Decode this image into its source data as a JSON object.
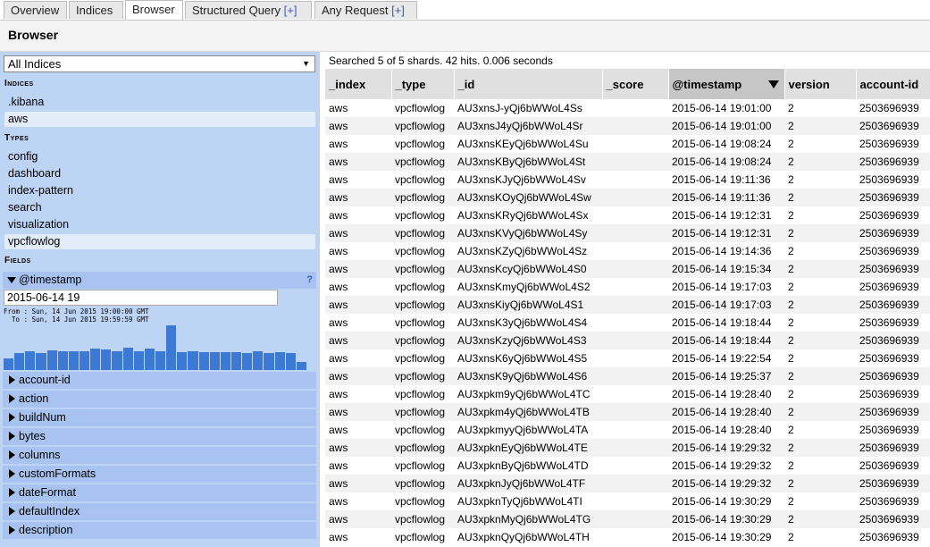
{
  "tabs": [
    {
      "label": "Overview"
    },
    {
      "label": "Indices"
    },
    {
      "label": "Browser"
    },
    {
      "label": "Structured Query",
      "plus": "[+]"
    },
    {
      "label": "Any Request",
      "plus": "[+]"
    }
  ],
  "header": {
    "title": "Browser"
  },
  "sidebar": {
    "index_select": "All Indices",
    "indices_title": "Indices",
    "indices": [
      ".kibana",
      "aws"
    ],
    "types_title": "Types",
    "types": [
      "config",
      "dashboard",
      "index-pattern",
      "search",
      "visualization",
      "vpcflowlog"
    ],
    "fields_title": "Fields",
    "timestamp": {
      "label": "@timestamp",
      "help": "?",
      "value": "2015-06-14 19",
      "from": "From : Sun, 14 Jun 2015 19:00:00 GMT",
      "to": "  To : Sun, 14 Jun 2015 19:59:59 GMT",
      "histogram": [
        13,
        19,
        21,
        19,
        22,
        21,
        21,
        21,
        24,
        23,
        21,
        25,
        21,
        24,
        21,
        50,
        20,
        21,
        20,
        20,
        20,
        20,
        19,
        21,
        19,
        20,
        19,
        9
      ]
    },
    "fields": [
      "account-id",
      "action",
      "buildNum",
      "bytes",
      "columns",
      "customFormats",
      "dateFormat",
      "defaultIndex",
      "description"
    ]
  },
  "results": {
    "summary": "Searched 5 of 5 shards. 42 hits. 0.006 seconds",
    "columns": [
      "_index",
      "_type",
      "_id",
      "_score",
      "@timestamp",
      "version",
      "account-id"
    ],
    "rows": [
      [
        "aws",
        "vpcflowlog",
        "AU3xnsJ-yQj6bWWoL4Ss",
        "",
        "2015-06-14 19:01:00",
        "2",
        "2503696939"
      ],
      [
        "aws",
        "vpcflowlog",
        "AU3xnsJ4yQj6bWWoL4Sr",
        "",
        "2015-06-14 19:01:00",
        "2",
        "2503696939"
      ],
      [
        "aws",
        "vpcflowlog",
        "AU3xnsKEyQj6bWWoL4Su",
        "",
        "2015-06-14 19:08:24",
        "2",
        "2503696939"
      ],
      [
        "aws",
        "vpcflowlog",
        "AU3xnsKByQj6bWWoL4St",
        "",
        "2015-06-14 19:08:24",
        "2",
        "2503696939"
      ],
      [
        "aws",
        "vpcflowlog",
        "AU3xnsKJyQj6bWWoL4Sv",
        "",
        "2015-06-14 19:11:36",
        "2",
        "2503696939"
      ],
      [
        "aws",
        "vpcflowlog",
        "AU3xnsKOyQj6bWWoL4Sw",
        "",
        "2015-06-14 19:11:36",
        "2",
        "2503696939"
      ],
      [
        "aws",
        "vpcflowlog",
        "AU3xnsKRyQj6bWWoL4Sx",
        "",
        "2015-06-14 19:12:31",
        "2",
        "2503696939"
      ],
      [
        "aws",
        "vpcflowlog",
        "AU3xnsKVyQj6bWWoL4Sy",
        "",
        "2015-06-14 19:12:31",
        "2",
        "2503696939"
      ],
      [
        "aws",
        "vpcflowlog",
        "AU3xnsKZyQj6bWWoL4Sz",
        "",
        "2015-06-14 19:14:36",
        "2",
        "2503696939"
      ],
      [
        "aws",
        "vpcflowlog",
        "AU3xnsKcyQj6bWWoL4S0",
        "",
        "2015-06-14 19:15:34",
        "2",
        "2503696939"
      ],
      [
        "aws",
        "vpcflowlog",
        "AU3xnsKmyQj6bWWoL4S2",
        "",
        "2015-06-14 19:17:03",
        "2",
        "2503696939"
      ],
      [
        "aws",
        "vpcflowlog",
        "AU3xnsKiyQj6bWWoL4S1",
        "",
        "2015-06-14 19:17:03",
        "2",
        "2503696939"
      ],
      [
        "aws",
        "vpcflowlog",
        "AU3xnsK3yQj6bWWoL4S4",
        "",
        "2015-06-14 19:18:44",
        "2",
        "2503696939"
      ],
      [
        "aws",
        "vpcflowlog",
        "AU3xnsKzyQj6bWWoL4S3",
        "",
        "2015-06-14 19:18:44",
        "2",
        "2503696939"
      ],
      [
        "aws",
        "vpcflowlog",
        "AU3xnsK6yQj6bWWoL4S5",
        "",
        "2015-06-14 19:22:54",
        "2",
        "2503696939"
      ],
      [
        "aws",
        "vpcflowlog",
        "AU3xnsK9yQj6bWWoL4S6",
        "",
        "2015-06-14 19:25:37",
        "2",
        "2503696939"
      ],
      [
        "aws",
        "vpcflowlog",
        "AU3xpkm9yQj6bWWoL4TC",
        "",
        "2015-06-14 19:28:40",
        "2",
        "2503696939"
      ],
      [
        "aws",
        "vpcflowlog",
        "AU3xpkm4yQj6bWWoL4TB",
        "",
        "2015-06-14 19:28:40",
        "2",
        "2503696939"
      ],
      [
        "aws",
        "vpcflowlog",
        "AU3xpkmyyQj6bWWoL4TA",
        "",
        "2015-06-14 19:28:40",
        "2",
        "2503696939"
      ],
      [
        "aws",
        "vpcflowlog",
        "AU3xpknEyQj6bWWoL4TE",
        "",
        "2015-06-14 19:29:32",
        "2",
        "2503696939"
      ],
      [
        "aws",
        "vpcflowlog",
        "AU3xpknByQj6bWWoL4TD",
        "",
        "2015-06-14 19:29:32",
        "2",
        "2503696939"
      ],
      [
        "aws",
        "vpcflowlog",
        "AU3xpknJyQj6bWWoL4TF",
        "",
        "2015-06-14 19:29:32",
        "2",
        "2503696939"
      ],
      [
        "aws",
        "vpcflowlog",
        "AU3xpknTyQj6bWWoL4TI",
        "",
        "2015-06-14 19:30:29",
        "2",
        "2503696939"
      ],
      [
        "aws",
        "vpcflowlog",
        "AU3xpknMyQj6bWWoL4TG",
        "",
        "2015-06-14 19:30:29",
        "2",
        "2503696939"
      ],
      [
        "aws",
        "vpcflowlog",
        "AU3xpknQyQj6bWWoL4TH",
        "",
        "2015-06-14 19:30:29",
        "2",
        "2503696939"
      ]
    ]
  }
}
